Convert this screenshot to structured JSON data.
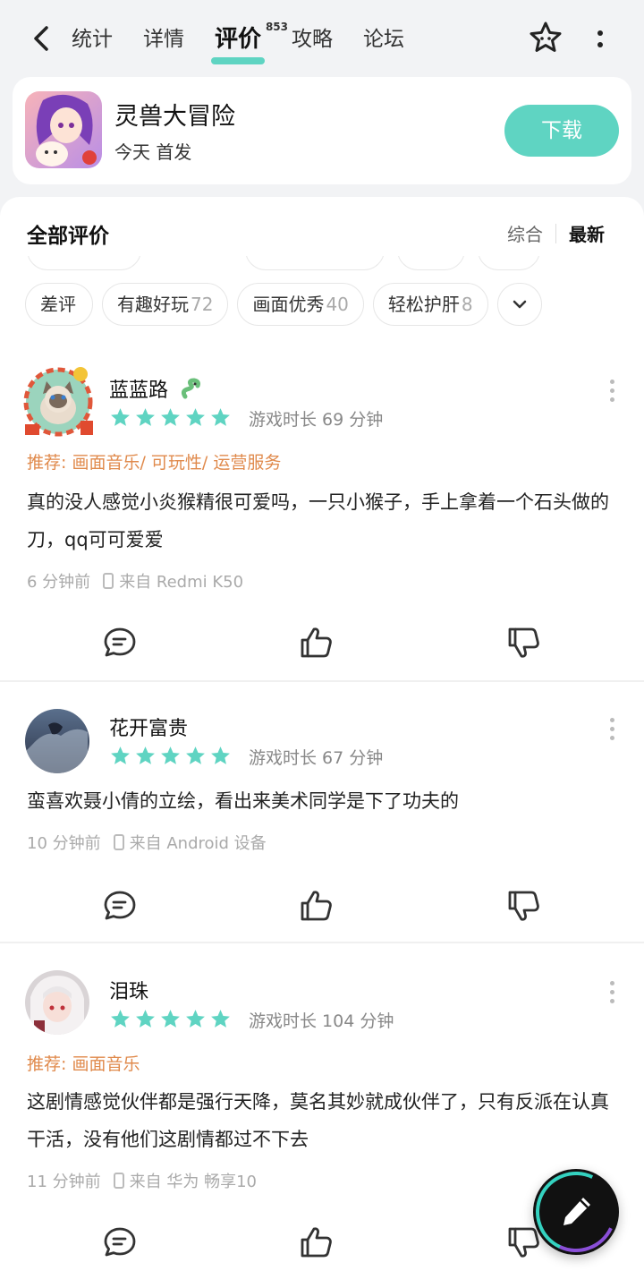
{
  "nav": {
    "tabs": [
      {
        "label": "统计"
      },
      {
        "label": "详情"
      },
      {
        "label": "评价",
        "count": "853"
      },
      {
        "label": "攻略"
      },
      {
        "label": "论坛"
      }
    ]
  },
  "game": {
    "name": "灵兽大冒险",
    "subtitle": "今天 首发",
    "download_label": "下载"
  },
  "reviews_header": {
    "title": "全部评价",
    "sort_options": [
      "综合",
      "最新"
    ]
  },
  "filter_chips": [
    {
      "label": "差评",
      "count": ""
    },
    {
      "label": "有趣好玩",
      "count": "72"
    },
    {
      "label": "画面优秀",
      "count": "40"
    },
    {
      "label": "轻松护肝",
      "count": "8"
    }
  ],
  "reviews": [
    {
      "username": "蓝蓝路",
      "rating": 5,
      "playtime": "游戏时长 69 分钟",
      "recommend": "推荐: 画面音乐/ 可玩性/ 运营服务",
      "content": "真的没人感觉小炎猴精很可爱吗，一只小猴子，手上拿着一个石头做的刀，qq可可爱爱",
      "time": "6 分钟前",
      "device": "来自 Redmi K50"
    },
    {
      "username": "花开富贵",
      "rating": 5,
      "playtime": "游戏时长 67 分钟",
      "recommend": "",
      "content": "蛮喜欢聂小倩的立绘，看出来美术同学是下了功夫的",
      "time": "10 分钟前",
      "device": "来自 Android 设备"
    },
    {
      "username": "泪珠",
      "rating": 5,
      "playtime": "游戏时长 104 分钟",
      "recommend": "推荐: 画面音乐",
      "content": "这剧情感觉伙伴都是强行天降，莫名其妙就成伙伴了，只有反派在认真干活，没有他们这剧情都过不下去",
      "time": "11 分钟前",
      "device": "来自 华为 畅享10"
    }
  ],
  "colors": {
    "accent": "#5fd4c2",
    "star": "#5fd4c2",
    "recommend": "#e08a4c",
    "page_bg": "#f2f3f5"
  },
  "icons": {
    "back": "chevron-left-icon",
    "favorite": "star-outline-icon",
    "more": "more-vertical-icon",
    "comment": "comment-icon",
    "like": "thumbs-up-icon",
    "dislike": "thumbs-down-icon",
    "edit": "pen-icon"
  }
}
